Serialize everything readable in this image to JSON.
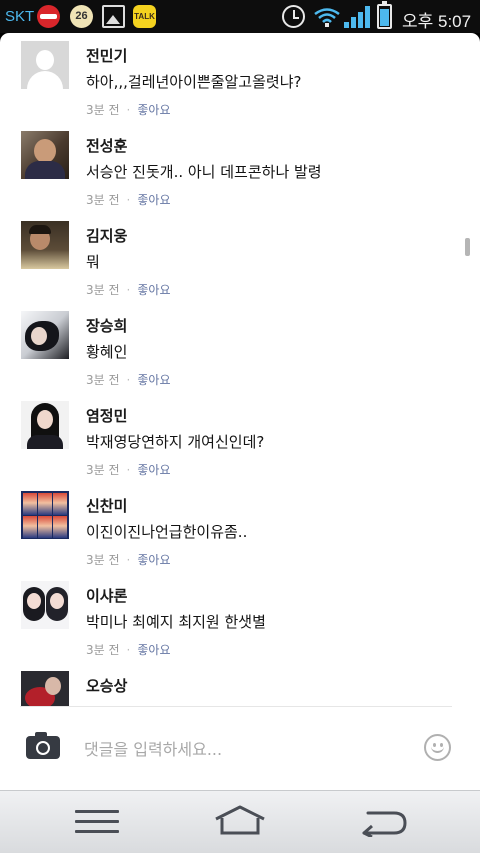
{
  "status_bar": {
    "carrier": "SKT",
    "calendar_day": "26",
    "talk_label": "TALK",
    "clock": "오후 5:07",
    "battery_level": 0.8,
    "icons": [
      "coupang-icon",
      "calendar-icon",
      "gallery-icon",
      "kakaotalk-icon",
      "alarm-icon",
      "wifi-icon",
      "signal-icon",
      "battery-icon"
    ],
    "accent_color": "#4db9ee"
  },
  "comments": [
    {
      "author": "전민기",
      "text": "하아,,,걸레년아이쁜줄알고올렷냐?",
      "time": "3분 전",
      "like": "좋아요"
    },
    {
      "author": "전성훈",
      "text": "서승안 진돗개.. 아니 데프콘하나 발령",
      "time": "3분 전",
      "like": "좋아요"
    },
    {
      "author": "김지웅",
      "text": "뭐",
      "time": "3분 전",
      "like": "좋아요"
    },
    {
      "author": "장승희",
      "text": "황혜인",
      "time": "3분 전",
      "like": "좋아요"
    },
    {
      "author": "염정민",
      "text": "박재영당연하지 개여신인데?",
      "time": "3분 전",
      "like": "좋아요"
    },
    {
      "author": "신찬미",
      "text": "이진이진나언급한이유좀..",
      "time": "3분 전",
      "like": "좋아요"
    },
    {
      "author": "이샤론",
      "text": "박미나 최예지 최지원 한샛별",
      "time": "3분 전",
      "like": "좋아요"
    },
    {
      "author": "오승상",
      "text": "",
      "time": "",
      "like": ""
    }
  ],
  "input": {
    "placeholder": "댓글을 입력하세요...",
    "value": ""
  },
  "nav": {
    "icons": [
      "menu-icon",
      "home-icon",
      "back-icon"
    ]
  },
  "colors": {
    "like_link": "#6576a3",
    "meta_text": "#9a9a9a",
    "nav_icon": "#4a4e56"
  }
}
